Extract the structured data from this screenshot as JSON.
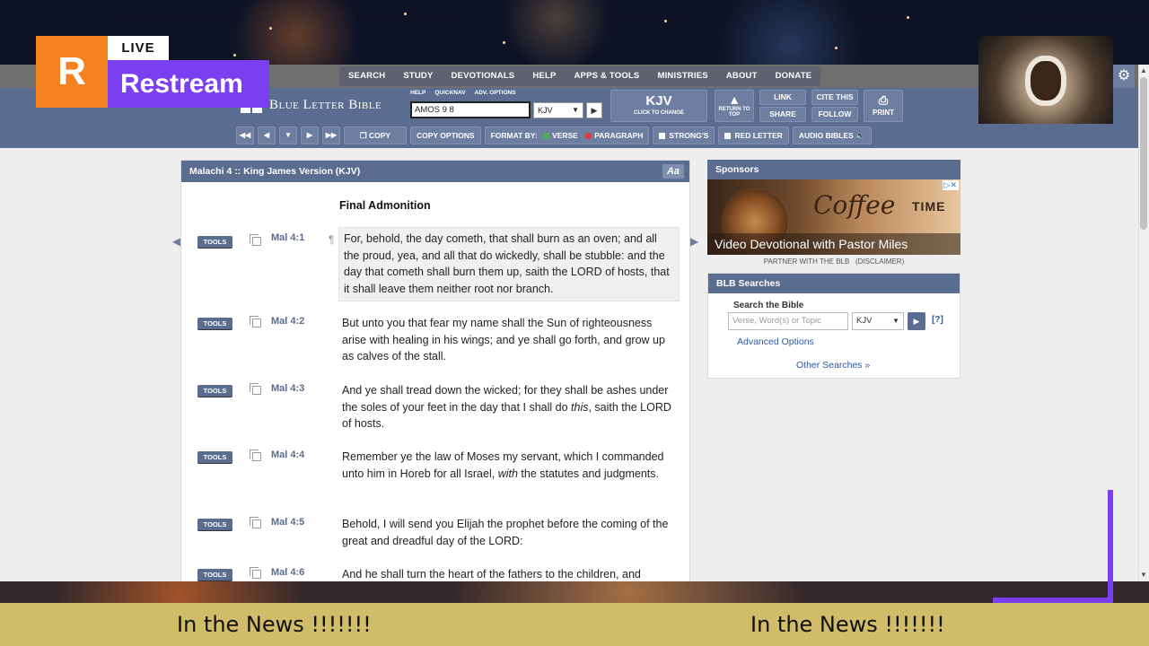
{
  "stream": {
    "brand_initial": "R",
    "live_label": "LIVE",
    "brand_name": "Restream",
    "ticker_left": "In the News !!!!!!!",
    "ticker_right": "In the News !!!!!!!",
    "accent_purple": "#7b3ff2",
    "accent_orange": "#f58220",
    "ticker_bg": "#d1bc6a"
  },
  "topnav": {
    "items": [
      "SEARCH",
      "STUDY",
      "DEVOTIONALS",
      "HELP",
      "APPS & TOOLS",
      "MINISTRIES",
      "ABOUT",
      "DONATE"
    ]
  },
  "header": {
    "logo_text": "Blue Letter Bible",
    "mini_links": [
      "HELP",
      "QUICKNAV",
      "ADV. OPTIONS"
    ],
    "search_value": "AMOS 9 8",
    "version": "KJV",
    "kjv_label": "KJV",
    "kjv_sub": "CLICK TO CHANGE",
    "return_label": "RETURN TO TOP",
    "link_label": "LINK",
    "share_label": "SHARE",
    "cite_label": "CITE THIS",
    "follow_label": "FOLLOW",
    "print_label": "PRINT",
    "brand_color": "#5a6c8f"
  },
  "toolbar": {
    "copy_label": "COPY",
    "copy_options_label": "COPY OPTIONS",
    "format_by_label": "FORMAT BY:",
    "verse_label": "VERSE",
    "paragraph_label": "PARAGRAPH",
    "strongs_label": "STRONG'S",
    "red_letter_label": "RED LETTER",
    "audio_label": "AUDIO BIBLES"
  },
  "passage": {
    "heading": "Malachi 4 :: King James Version (KJV)",
    "font_toggle": "Aa",
    "section_title": "Final Admonition",
    "tools_label": "TOOLS",
    "verses": [
      {
        "ref": "Mal 4:1",
        "text": "For, behold, the day cometh, that shall burn as an oven; and all the proud, yea, and all that do wickedly, shall be stubble: and the day that cometh shall burn them up, saith the LORD of hosts, that it shall leave them neither root nor branch."
      },
      {
        "ref": "Mal 4:2",
        "text": "But unto you that fear my name shall the Sun of righteousness arise with healing in his wings; and ye shall go forth, and grow up as calves of the stall."
      },
      {
        "ref": "Mal 4:3",
        "text_a": "And ye shall tread down the wicked; for they shall be ashes under the soles of your feet in the day that I shall do ",
        "text_italic": "this",
        "text_b": ", saith the LORD of hosts."
      },
      {
        "ref": "Mal 4:4",
        "text_a": "Remember ye the law of Moses my servant, which I commanded unto him in Horeb for all Israel, ",
        "text_italic": "with",
        "text_b": " the statutes and judgments."
      },
      {
        "ref": "Mal 4:5",
        "text": "Behold, I will send you Elijah the prophet before the coming of the great and dreadful day of the LORD:"
      },
      {
        "ref": "Mal 4:6",
        "text": "And he shall turn the heart of the fathers to the children, and"
      }
    ]
  },
  "sidebar": {
    "sponsors_title": "Sponsors",
    "ad_word1": "Coffee",
    "ad_word2": "TIME",
    "ad_caption": "Video Devotional with Pastor Miles",
    "partner_text": "PARTNER WITH THE BLB",
    "disclaimer_text": "(DISCLAIMER)",
    "search_title": "BLB Searches",
    "search_label": "Search the Bible",
    "search_placeholder": "Verse, Word(s) or Topic",
    "search_version": "KJV",
    "help_link": "[?]",
    "advanced_link": "Advanced Options",
    "other_link": "Other Searches »"
  }
}
